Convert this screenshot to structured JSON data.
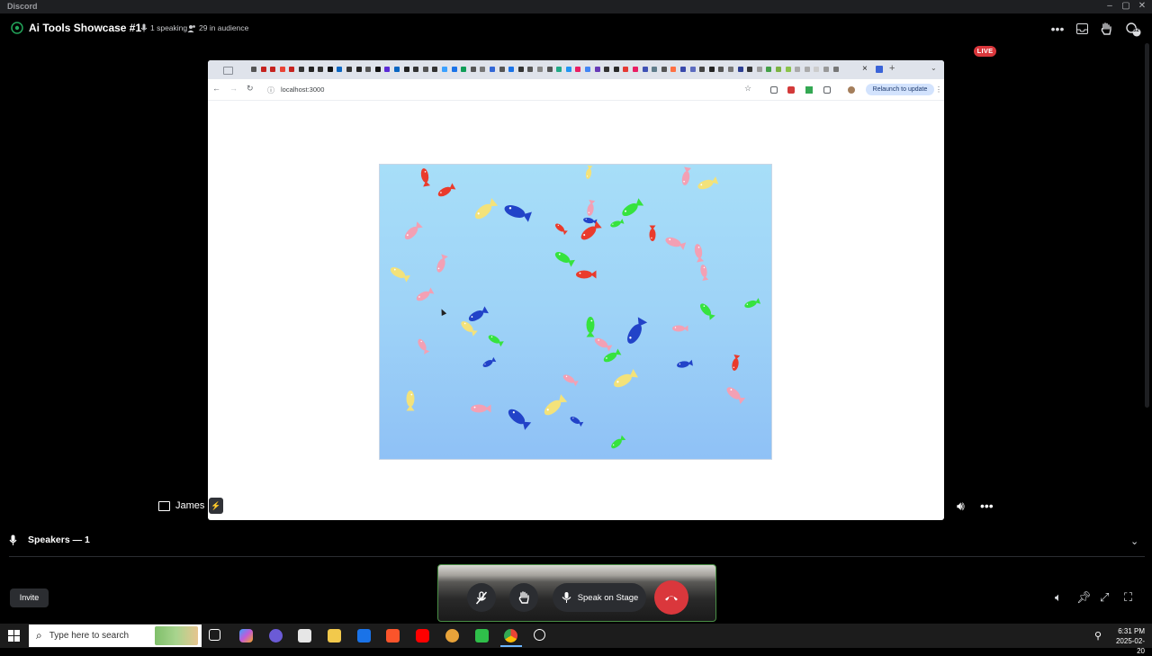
{
  "window": {
    "app_name": "Discord",
    "controls": [
      "–",
      "▢",
      "✕"
    ]
  },
  "stage": {
    "title": "Ai Tools Showcase #1",
    "speaking": "1 speaking",
    "audience": "29 in audience",
    "badge_count": "32",
    "live_label": "LIVE"
  },
  "browser": {
    "url": "localhost:3000",
    "relaunch_label": "Relaunch to update",
    "tab_close": "×",
    "tab_new": "+"
  },
  "tile": {
    "name": "James"
  },
  "speakers": {
    "label": "Speakers — 1"
  },
  "controls": {
    "invite_label": "Invite",
    "speak_label": "Speak on Stage"
  },
  "taskbar": {
    "search_placeholder": "Type here to search",
    "time": "6:31 PM",
    "date": "2025-02-20"
  },
  "colors": {
    "live_red": "#da373c",
    "discord_panel": "#2b2d31",
    "aquarium_top": "#a7def8",
    "aquarium_bottom": "#8fc1f6",
    "fish": {
      "red": "#ea3b2c",
      "pink": "#f3a0b4",
      "yellow": "#f3e27a",
      "blue": "#2243c8",
      "green": "#36e33e"
    }
  }
}
